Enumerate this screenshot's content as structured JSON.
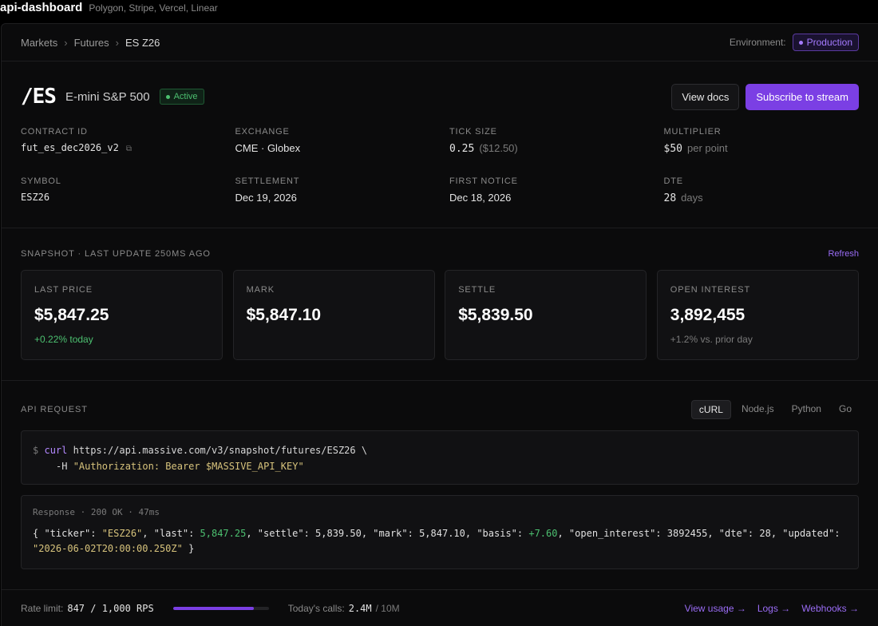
{
  "app": {
    "title": "api-dashboard",
    "subtitle": "Polygon, Stripe, Vercel, Linear"
  },
  "breadcrumb": {
    "items": [
      "Markets",
      "Futures",
      "ES Z26"
    ],
    "separator": "›"
  },
  "environment": {
    "label": "Environment:",
    "value": "Production"
  },
  "contract": {
    "ticker": "/ES",
    "name": "E-mini S&P 500",
    "status": "Active",
    "buttons": {
      "docs": "View docs",
      "subscribe": "Subscribe to stream"
    },
    "fields": {
      "contract_id": {
        "label": "CONTRACT ID",
        "value": "fut_es_dec2026_v2"
      },
      "exchange": {
        "label": "EXCHANGE",
        "value": "CME · Globex"
      },
      "tick_size": {
        "label": "TICK SIZE",
        "value": "0.25",
        "extra": "($12.50)"
      },
      "multiplier": {
        "label": "MULTIPLIER",
        "value": "$50",
        "extra": "per point"
      },
      "symbol": {
        "label": "SYMBOL",
        "value": "ESZ26"
      },
      "settlement": {
        "label": "SETTLEMENT",
        "value": "Dec 19, 2026"
      },
      "first_notice": {
        "label": "FIRST NOTICE",
        "value": "Dec 18, 2026"
      },
      "dte": {
        "label": "DTE",
        "value": "28",
        "extra": "days"
      }
    }
  },
  "snapshot": {
    "title": "SNAPSHOT · LAST UPDATE 250MS AGO",
    "refresh": "Refresh",
    "cards": [
      {
        "label": "LAST PRICE",
        "value": "$5,847.25",
        "sub": "+0.22% today"
      },
      {
        "label": "MARK",
        "value": "$5,847.10",
        "sub": ""
      },
      {
        "label": "SETTLE",
        "value": "$5,839.50",
        "sub": ""
      },
      {
        "label": "OPEN INTEREST",
        "value": "3,892,455",
        "sub": "+1.2% vs. prior day"
      }
    ]
  },
  "api": {
    "title": "API REQUEST",
    "tabs": [
      "cURL",
      "Node.js",
      "Python",
      "Go"
    ],
    "active_tab": "cURL",
    "request": {
      "prompt": "$",
      "cmd": "curl",
      "url": "https://api.massive.com/v3/snapshot/futures/ESZ26 \\",
      "flag": "-H",
      "header": "\"Authorization: Bearer $MASSIVE_API_KEY\""
    },
    "response": {
      "meta": "Response · 200 OK · 47ms",
      "open": "{ \"ticker\": ",
      "ticker": "\"ESZ26\"",
      "k_last": ", \"last\": ",
      "last": "5,847.25",
      "k_settle": ", \"settle\": ",
      "settle": "5,839.50",
      "k_mark": ", \"mark\": ",
      "mark": "5,847.10",
      "k_basis": ", \"basis\": ",
      "basis": "+7.60",
      "k_oi": ", \"open_interest\": ",
      "open_interest": "3892455",
      "k_dte": ", \"dte\": ",
      "dte": "28",
      "k_updated": ", \"updated\":",
      "updated": "\"2026-06-02T20:00:00.250Z\"",
      "close": " }"
    }
  },
  "footer": {
    "rate_label": "Rate limit:",
    "rate_value": "847 / 1,000 RPS",
    "rate_fraction": 0.847,
    "calls_label": "Today's calls:",
    "calls_value": "2.4M",
    "calls_limit": "/ 10M",
    "links": [
      "View usage →",
      "Logs →",
      "Webhooks →"
    ]
  },
  "colors": {
    "accent": "#7b3fe4",
    "positive": "#4cc070",
    "background": "#0b0b0c"
  }
}
